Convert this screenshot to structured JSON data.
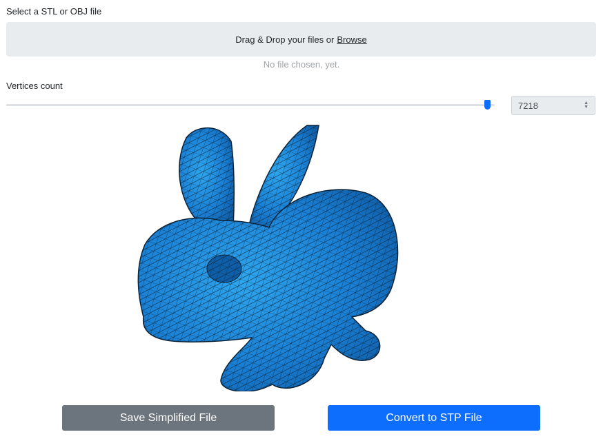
{
  "file_select": {
    "label": "Select a STL or OBJ file",
    "dropzone_text": "Drag & Drop your files or",
    "browse_label": "Browse",
    "status": "No file chosen, yet."
  },
  "vertices": {
    "label": "Vertices count",
    "value": "7218",
    "slider_fraction": 0.985
  },
  "model": {
    "color": "#1a7fd4",
    "mesh_color": "#0b2236"
  },
  "buttons": {
    "save_label": "Save Simplified File",
    "convert_label": "Convert to STP File"
  },
  "colors": {
    "primary": "#0d6efd",
    "secondary": "#6c757d"
  }
}
